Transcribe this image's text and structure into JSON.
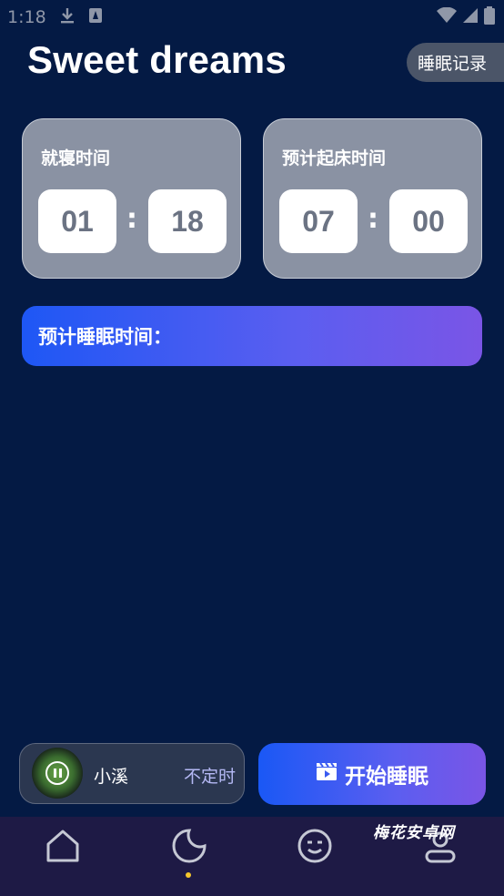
{
  "status_bar": {
    "time": "1:18"
  },
  "header": {
    "title": "Sweet dreams",
    "records_label": "睡眠记录"
  },
  "bedtime_card": {
    "label": "就寝时间",
    "hour": "01",
    "minute": "18",
    "separator": ":"
  },
  "wake_card": {
    "label": "预计起床时间",
    "hour": "07",
    "minute": "00",
    "separator": ":"
  },
  "sleep_duration": {
    "label": "预计睡眠时间："
  },
  "player": {
    "track": "小溪",
    "timer_mode": "不定时",
    "state": "playing"
  },
  "start_button": {
    "label": "开始睡眠"
  },
  "bottom_nav": {
    "items": [
      {
        "icon": "home-icon",
        "active": false
      },
      {
        "icon": "moon-icon",
        "active": true
      },
      {
        "icon": "smiley-icon",
        "active": false
      },
      {
        "icon": "profile-icon",
        "active": false
      }
    ]
  },
  "watermark": {
    "text": "梅花安卓网"
  },
  "colors": {
    "background": "#041a44",
    "card": "#8a92a3",
    "accent_start": "#1a58f5",
    "accent_end": "#7a55e6",
    "nav_bg": "#1e1a45",
    "active_dot": "#f5c72c"
  }
}
